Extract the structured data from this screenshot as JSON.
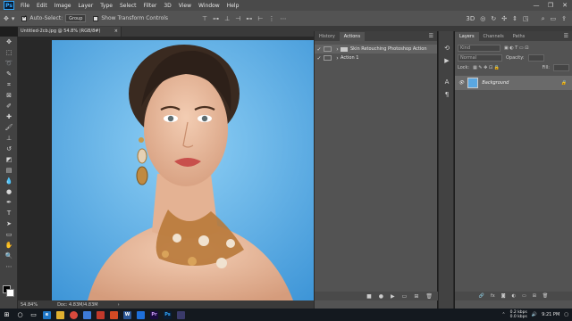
{
  "menu": {
    "logo": "Ps",
    "items": [
      "File",
      "Edit",
      "Image",
      "Layer",
      "Type",
      "Select",
      "Filter",
      "3D",
      "View",
      "Window",
      "Help"
    ],
    "window_controls": [
      "—",
      "❐",
      "✕"
    ]
  },
  "options": {
    "auto_select_label": "Auto-Select:",
    "auto_select_value": "Group",
    "show_transform_label": "Show Transform Controls"
  },
  "document": {
    "tab_title": "Untitled-2cb.jpg @ 54.8% (RGB/8#)",
    "close": "×"
  },
  "status": {
    "zoom": "54.84%",
    "doc": "Doc: 4.83M/4.83M",
    "arrow": "›"
  },
  "actions_panel": {
    "tabs": [
      "History",
      "Actions"
    ],
    "active_tab": "Actions",
    "set_name": "Skin Retouching Photoshop Action",
    "action_name": "Action 1"
  },
  "layers_panel": {
    "tabs": [
      "Layers",
      "Channels",
      "Paths"
    ],
    "active_tab": "Layers",
    "kind_placeholder": "Kind",
    "blend_mode": "Normal",
    "opacity_label": "Opacity:",
    "lock_label": "Lock:",
    "fill_label": "Fill:",
    "layer_name": "Background"
  },
  "taskbar": {
    "search_icon": "search-icon",
    "net_up": "0.2 kbps",
    "net_down": "0.0 kbps",
    "time": "9:21 PM"
  },
  "colors": {
    "photoshop_blue": "#31a8ff",
    "photo_background": "#5fb0e8"
  }
}
